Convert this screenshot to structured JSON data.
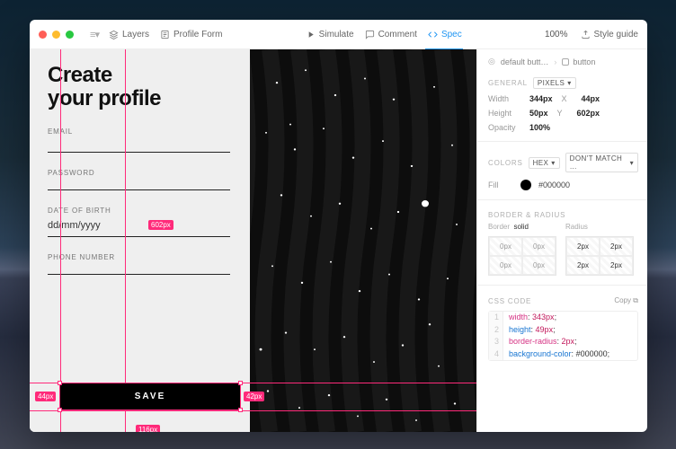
{
  "toolbar": {
    "layers": "Layers",
    "doc_name": "Profile Form",
    "simulate": "Simulate",
    "comment": "Comment",
    "spec": "Spec",
    "zoom": "100%",
    "style_guide": "Style guide"
  },
  "canvas": {
    "title_line1": "Create",
    "title_line2": "your profile",
    "labels": {
      "email": "EMAIL",
      "password": "PASSWORD",
      "dob": "DATE OF BIRTH",
      "dob_value": "dd/mm/yyyy",
      "phone": "PHONE NUMBER"
    },
    "save_label": "SAVE",
    "badges": {
      "password_right": "602px",
      "left_margin": "44px",
      "right_margin": "42px",
      "below": "116px"
    }
  },
  "inspector": {
    "breadcrumb_parent": "default butt…",
    "breadcrumb_current": "button",
    "general_label": "GENERAL",
    "pixels_pill": "PIXELS",
    "width_label": "Width",
    "width_val": "344px",
    "x_label": "X",
    "x_val": "44px",
    "height_label": "Height",
    "height_val": "50px",
    "y_label": "Y",
    "y_val": "602px",
    "opacity_label": "Opacity",
    "opacity_val": "100%",
    "colors_label": "COLORS",
    "hex_pill": "HEX",
    "match_pill": "DON'T MATCH …",
    "fill_label": "Fill",
    "fill_hex": "#000000",
    "border_radius_label": "BORDER & RADIUS",
    "border_label": "Border",
    "border_val": "solid",
    "radius_label": "Radius",
    "b": {
      "tl": "0px",
      "tr": "0px",
      "bl": "0px",
      "br": "0px"
    },
    "r": {
      "tl": "2px",
      "tr": "2px",
      "bl": "2px",
      "br": "2px"
    },
    "css_label": "CSS CODE",
    "copy_label": "Copy",
    "code": {
      "l1": "width: 343px;",
      "l2": "height: 49px;",
      "l3": "border-radius: 2px;",
      "l4": "background-color: #000000;"
    }
  }
}
